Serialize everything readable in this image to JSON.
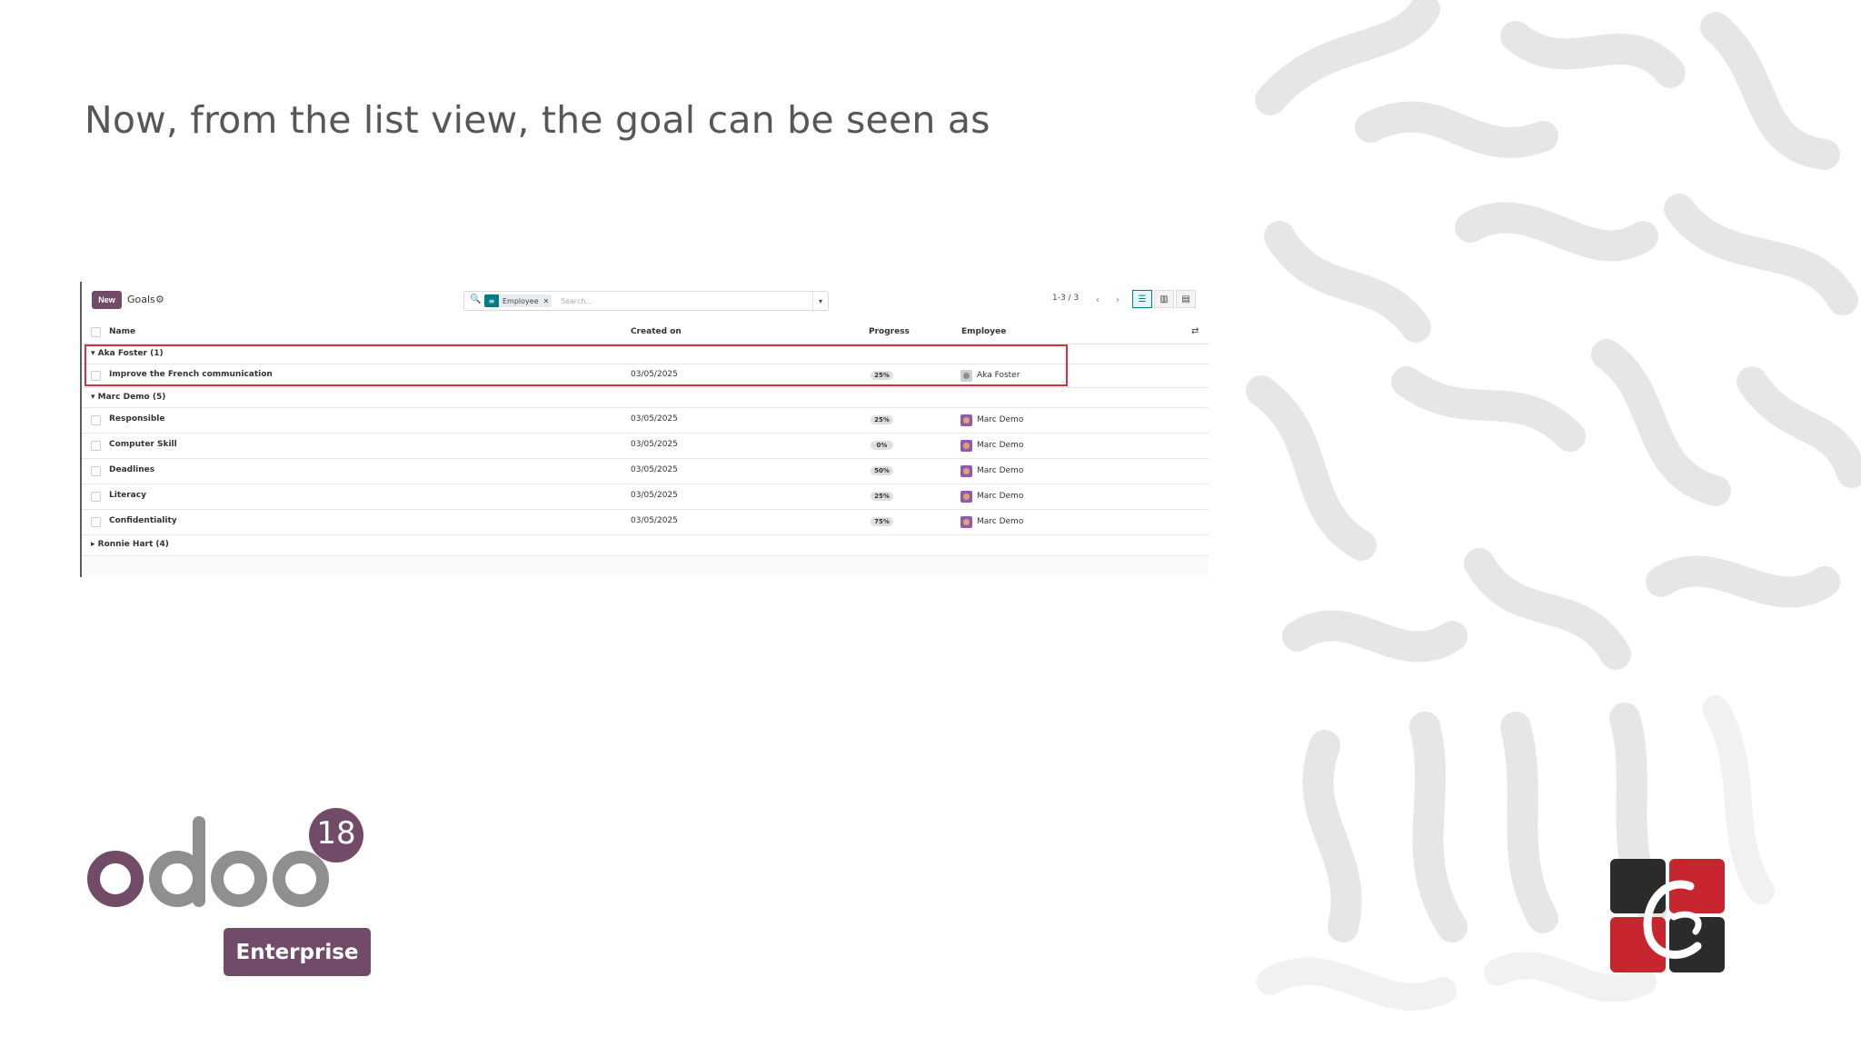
{
  "slide": {
    "title": "Now, from the list view, the goal can be seen as"
  },
  "screenshot": {
    "control_panel": {
      "new_button": "New",
      "breadcrumb": "Goals",
      "search": {
        "facet_label": "Employee",
        "placeholder": "Search..."
      },
      "pager": "1-3 / 3"
    },
    "columns": [
      "Name",
      "Created on",
      "Progress",
      "Employee"
    ],
    "groups": [
      {
        "label": "Aka Foster (1)",
        "expanded": true,
        "rows": [
          {
            "name": "Improve the French communication",
            "created_on": "03/05/2025",
            "progress": "25%",
            "employee": "Aka Foster"
          }
        ]
      },
      {
        "label": "Marc Demo (5)",
        "expanded": true,
        "rows": [
          {
            "name": "Responsible",
            "created_on": "03/05/2025",
            "progress": "25%",
            "employee": "Marc Demo"
          },
          {
            "name": "Computer Skill",
            "created_on": "03/05/2025",
            "progress": "0%",
            "employee": "Marc Demo"
          },
          {
            "name": "Deadlines",
            "created_on": "03/05/2025",
            "progress": "50%",
            "employee": "Marc Demo"
          },
          {
            "name": "Literacy",
            "created_on": "03/05/2025",
            "progress": "25%",
            "employee": "Marc Demo"
          },
          {
            "name": "Confidentiality",
            "created_on": "03/05/2025",
            "progress": "75%",
            "employee": "Marc Demo"
          }
        ]
      },
      {
        "label": "Ronnie Hart (4)",
        "expanded": false,
        "rows": []
      }
    ]
  },
  "branding": {
    "odoo_wordmark": "odoo",
    "version": "18",
    "edition": "Enterprise",
    "colors": {
      "odoo_purple": "#714b67",
      "odoo_grey": "#8f8f8f",
      "highlight_red": "#d6313b",
      "teal": "#017e84"
    }
  }
}
